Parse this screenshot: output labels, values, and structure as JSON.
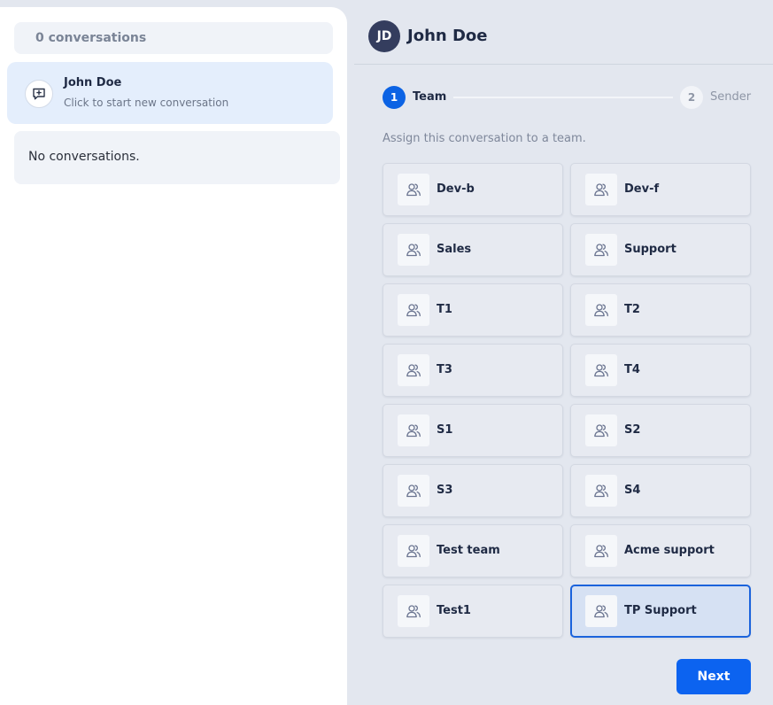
{
  "sidebar": {
    "conversation_count": "0 conversations",
    "new_conversation": {
      "name": "John Doe",
      "subtitle": "Click to start new conversation",
      "icon": "chat-add-icon"
    },
    "empty_message": "No conversations."
  },
  "header": {
    "avatar_initials": "JD",
    "name": "John Doe"
  },
  "stepper": {
    "steps": [
      {
        "number": "1",
        "label": "Team",
        "active": true
      },
      {
        "number": "2",
        "label": "Sender",
        "active": false
      }
    ]
  },
  "assign_prompt": "Assign this conversation to a team.",
  "teams": [
    {
      "name": "Dev-b",
      "selected": false
    },
    {
      "name": "Dev-f",
      "selected": false
    },
    {
      "name": "Sales",
      "selected": false
    },
    {
      "name": "Support",
      "selected": false
    },
    {
      "name": "T1",
      "selected": false
    },
    {
      "name": "T2",
      "selected": false
    },
    {
      "name": "T3",
      "selected": false
    },
    {
      "name": "T4",
      "selected": false
    },
    {
      "name": "S1",
      "selected": false
    },
    {
      "name": "S2",
      "selected": false
    },
    {
      "name": "S3",
      "selected": false
    },
    {
      "name": "S4",
      "selected": false
    },
    {
      "name": "Test team",
      "selected": false
    },
    {
      "name": "Acme support",
      "selected": false
    },
    {
      "name": "Test1",
      "selected": false
    },
    {
      "name": "TP Support",
      "selected": true
    }
  ],
  "team_icon": "users-icon",
  "next_label": "Next",
  "colors": {
    "accent": "#0c63f0",
    "selected_border": "#1b63dc",
    "selected_bg": "#d6e1f3",
    "avatar_bg": "#343d5e"
  }
}
